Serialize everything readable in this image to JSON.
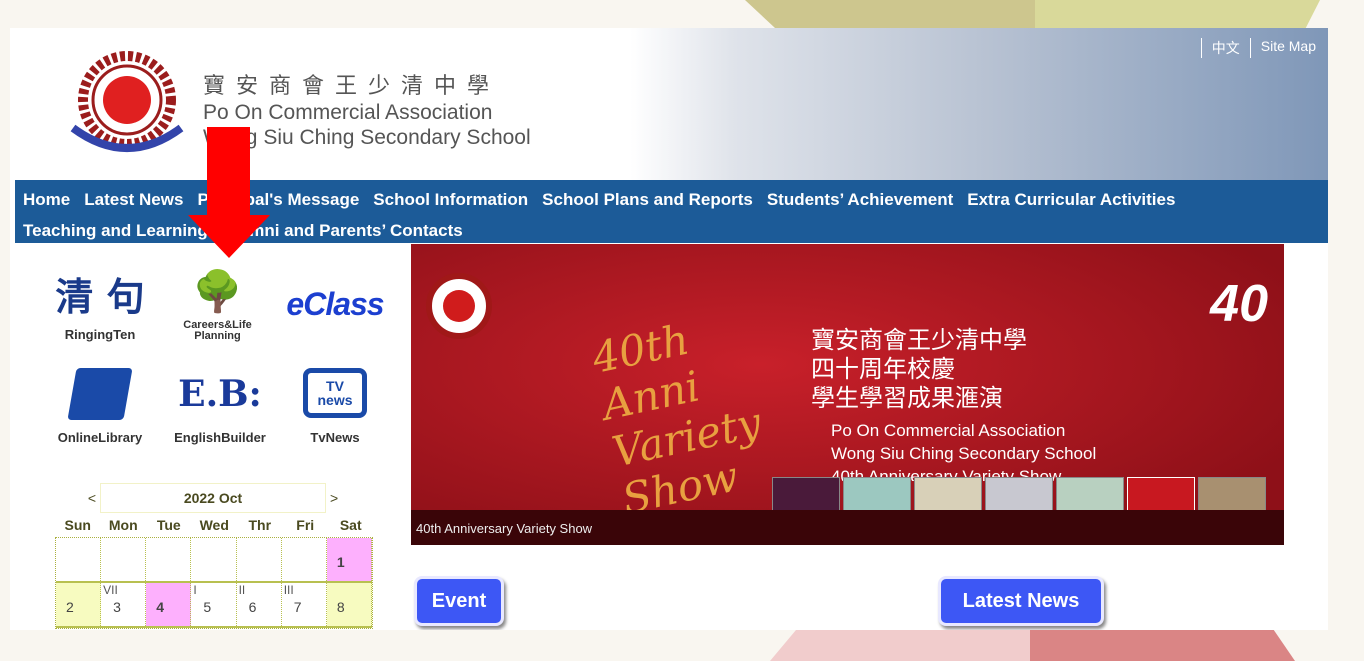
{
  "header": {
    "school_zh": "寶安商會王少清中學",
    "school_en1": "Po On Commercial Association",
    "school_en2": "Wong Siu Ching Secondary School",
    "links": [
      "中文",
      "Site Map"
    ]
  },
  "nav": {
    "items": [
      "Home",
      "Latest News",
      "Principal's Message",
      "School Information",
      "School Plans and Reports",
      "Students’ Achievement",
      "Extra Curricular Activities",
      "Teaching and Learning",
      "Alumni and Parents’ Contacts"
    ]
  },
  "shortcuts": [
    {
      "label": "RingingTen",
      "glyph": "清 句"
    },
    {
      "label": "Careers&Life Planning",
      "glyph": "🌳"
    },
    {
      "label": "",
      "glyph": "eClass"
    },
    {
      "label": "OnlineLibrary",
      "glyph": "📘"
    },
    {
      "label": "EnglishBuilder",
      "glyph": "E.B:"
    },
    {
      "label": "TvNews",
      "glyph": "TV news"
    }
  ],
  "calendar": {
    "prev": "<",
    "next": ">",
    "month": "2022 Oct",
    "days": [
      "Sun",
      "Mon",
      "Tue",
      "Wed",
      "Thr",
      "Fri",
      "Sat"
    ],
    "weeks": [
      [
        {
          "d": ""
        },
        {
          "d": ""
        },
        {
          "d": ""
        },
        {
          "d": ""
        },
        {
          "d": ""
        },
        {
          "d": ""
        },
        {
          "d": "1",
          "c": "pink"
        }
      ],
      [
        {
          "d": "2",
          "c": "yellow"
        },
        {
          "d": "3",
          "t": "VII"
        },
        {
          "d": "4",
          "c": "pink"
        },
        {
          "d": "5",
          "t": "I"
        },
        {
          "d": "6",
          "t": "II"
        },
        {
          "d": "7",
          "t": "III"
        },
        {
          "d": "8",
          "c": "yellow"
        }
      ]
    ]
  },
  "banner": {
    "title_zh": [
      "寶安商會王少清中學",
      "四十周年校慶",
      "學生學習成果滙演"
    ],
    "title_en": [
      "Po On Commercial Association",
      "Wong Siu Ching Secondary School",
      "40th Anniversary Variety Show"
    ],
    "script": "40th Anni Variety Show",
    "badge": "40",
    "caption": "40th Anniversary Variety Show",
    "thumbnails": 7
  },
  "buttons": {
    "event": "Event",
    "news": "Latest News"
  },
  "colors": {
    "nav": "#1c5b98",
    "button": "#3d57f5",
    "arrow": "#ff0000"
  }
}
